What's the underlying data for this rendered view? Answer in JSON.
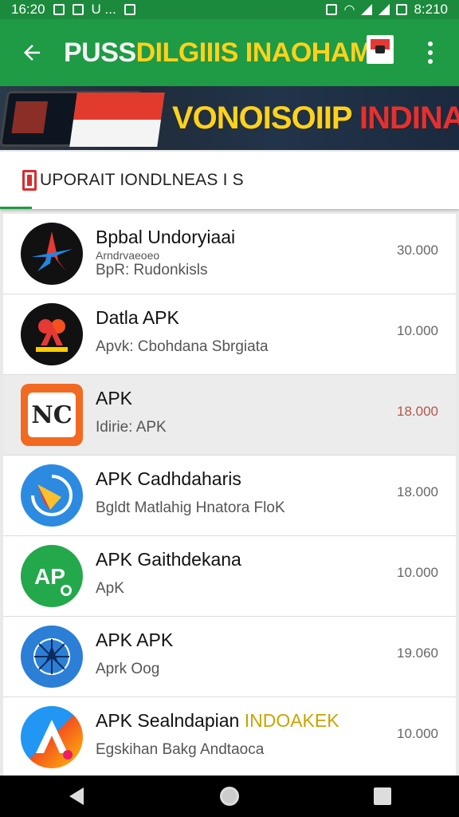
{
  "status_bar": {
    "time_left": "16:20",
    "notification_text": "U ...",
    "time_right": "8:210"
  },
  "app_bar": {
    "title_part1": "PUSS",
    "title_part2": "DILGIIIS INAOHAM",
    "icons": {
      "back": "arrow-left-icon",
      "flag": "flag-badge-icon",
      "menu": "more-vert-icon"
    }
  },
  "banner": {
    "text_yellow": "VONOISOIIP ",
    "text_red": "INDINASIAL"
  },
  "section": {
    "title": "UPORAIT IONDLNEAS I S",
    "accent_color": "#1f9a45"
  },
  "apps": [
    {
      "name": "Bpbal Undoryiaai",
      "tagline": "Arndrvaeoeo",
      "subtitle": "BpR: Rudonkisls",
      "price": "30.000",
      "icon": "star-compass-icon"
    },
    {
      "name": "Datla APK",
      "tagline": "",
      "subtitle": "Apvk: Cbohdana Sbrgiata",
      "price": "10.000",
      "icon": "red-a-icon"
    },
    {
      "name": "APK",
      "tagline": "",
      "subtitle": "Idirie: APK",
      "price": "18.000",
      "icon": "nc-logo-icon",
      "selected": true
    },
    {
      "name": "APK Cadhdaharis",
      "tagline": "",
      "subtitle": "Bgldt Matlahig Hnatora FloK",
      "price": "18.000",
      "icon": "blue-disc-icon"
    },
    {
      "name": "APK Gaithdekana",
      "tagline": "",
      "subtitle": "ApK",
      "price": "10.000",
      "icon": "green-ap-icon"
    },
    {
      "name": "APK APK",
      "tagline": "",
      "subtitle": "Aprk Oog",
      "price": "19.060",
      "icon": "blue-web-icon"
    },
    {
      "name": "APK Sealndapian ",
      "name_highlight": "INDOAKEK",
      "tagline": "",
      "subtitle": "Egskihan Bakg Andtaoca",
      "price": "10.000",
      "icon": "colorful-a-icon"
    }
  ],
  "nav": {
    "back": "nav-back-icon",
    "home": "nav-home-icon",
    "recent": "nav-recent-icon"
  },
  "colors": {
    "primary": "#1f9a45",
    "status_bar": "#1b8a3c",
    "title_yellow": "#ffd21a",
    "banner_red": "#e53030"
  }
}
